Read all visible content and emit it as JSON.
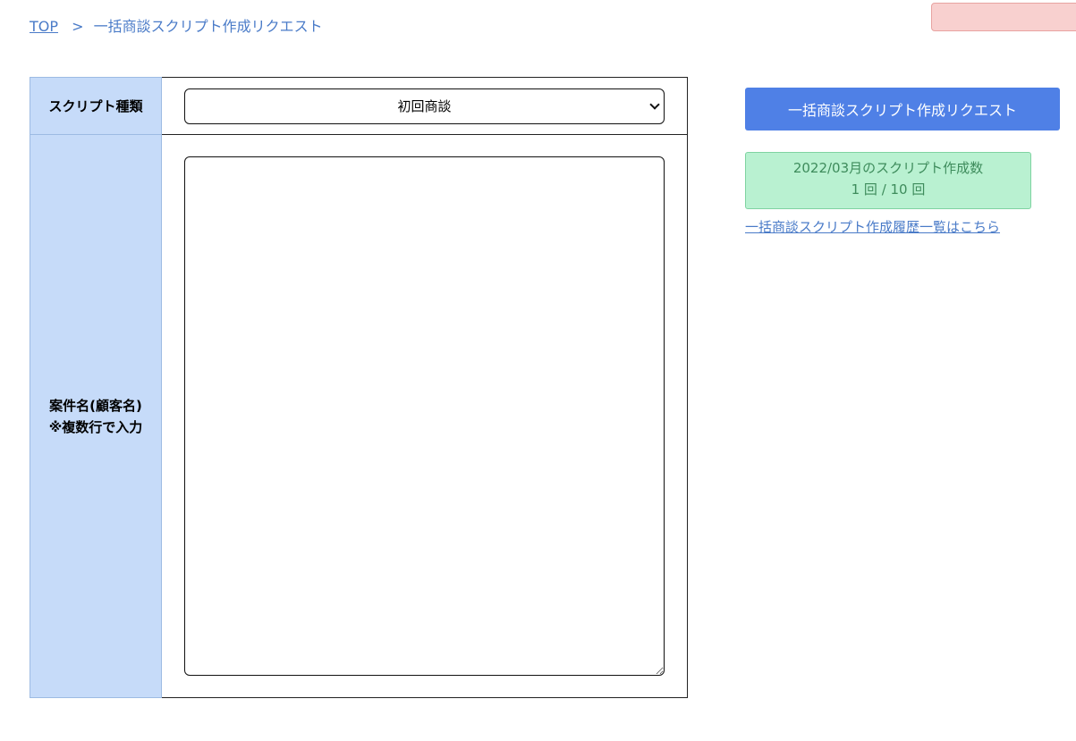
{
  "breadcrumb": {
    "home": "TOP",
    "separator": ">",
    "current": "一括商談スクリプト作成リクエスト"
  },
  "form": {
    "script_type_label": "スクリプト種類",
    "script_type_selected": "初回商談",
    "case_name_label_line1": "案件名(顧客名)",
    "case_name_label_line2": "※複数行で入力",
    "case_name_value": ""
  },
  "sidebar": {
    "submit_label": "一括商談スクリプト作成リクエスト",
    "count_title": "2022/03月のスクリプト作成数",
    "count_value": "1 回 / 10 回",
    "history_link": "一括商談スクリプト作成履歴一覧はこちら"
  },
  "colors": {
    "accent": "#4f80e6",
    "label_bg": "#c6dbf9",
    "success_bg": "#b9f1d1",
    "alert_bg": "#f8d0cf"
  }
}
